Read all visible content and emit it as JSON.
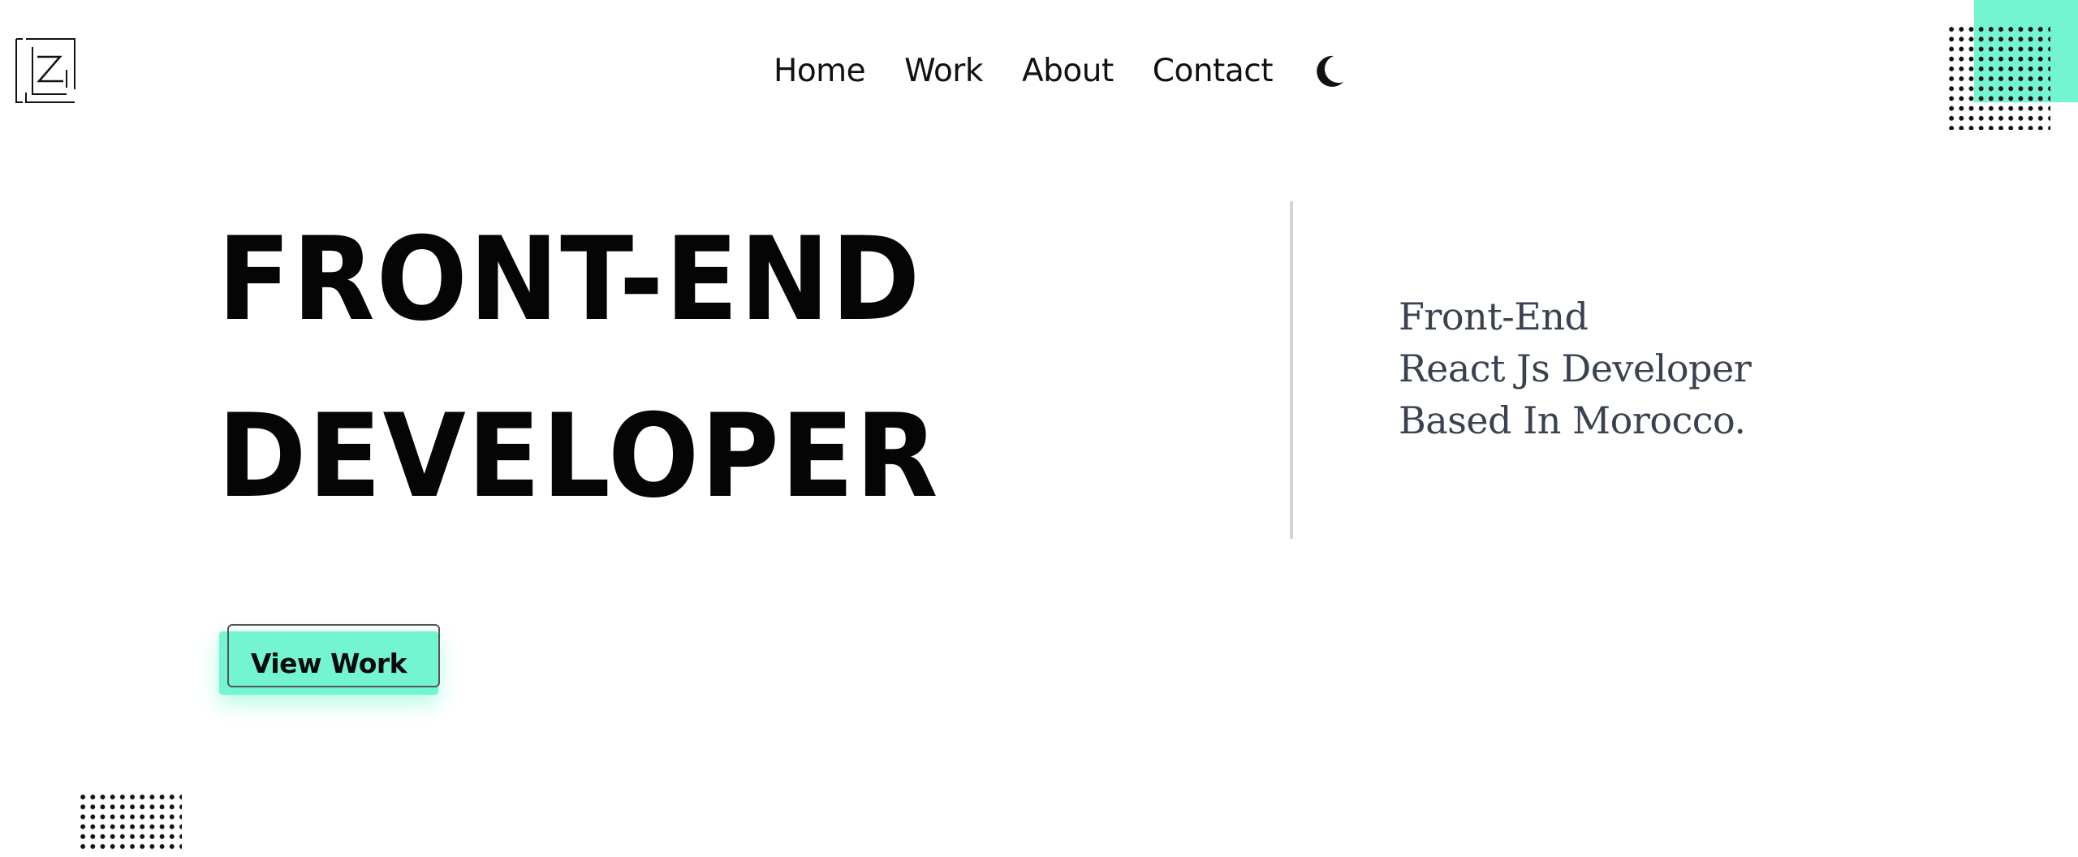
{
  "brand": {
    "logo_icon": "z-monogram-logo"
  },
  "nav": {
    "links": [
      {
        "label": "Home"
      },
      {
        "label": "Work"
      },
      {
        "label": "About"
      },
      {
        "label": "Contact"
      }
    ],
    "theme_toggle_icon": "moon-icon"
  },
  "hero": {
    "heading_line_1": "FRONT-END",
    "heading_line_2": "DEVELOPER",
    "tagline_lines": [
      "Front-End",
      "React Js Developer",
      "Based In Morocco."
    ],
    "cta_label": "View Work"
  },
  "colors": {
    "accent": "#72f5d0",
    "heading": "#050505",
    "tagline": "#3a4150",
    "divider": "#d4d4d4",
    "dots": "#111111"
  }
}
